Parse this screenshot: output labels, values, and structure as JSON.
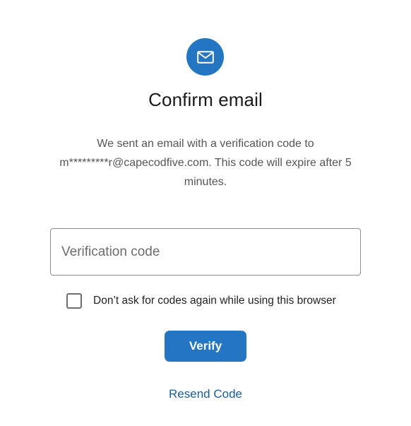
{
  "header": {
    "icon": "envelope-icon",
    "title": "Confirm email"
  },
  "message": {
    "line1": "We sent an email with a verification code to",
    "line2": "m*********r@capecodfive.com. This code will expire after 5",
    "line3": "minutes."
  },
  "form": {
    "code_placeholder": "Verification code",
    "code_value": "",
    "remember_checked": false,
    "remember_label": "Don’t ask for codes again while using this browser",
    "verify_label": "Verify",
    "resend_label": "Resend Code"
  },
  "colors": {
    "accent": "#2476c3",
    "link": "#1d5c9b",
    "text": "#555555"
  }
}
